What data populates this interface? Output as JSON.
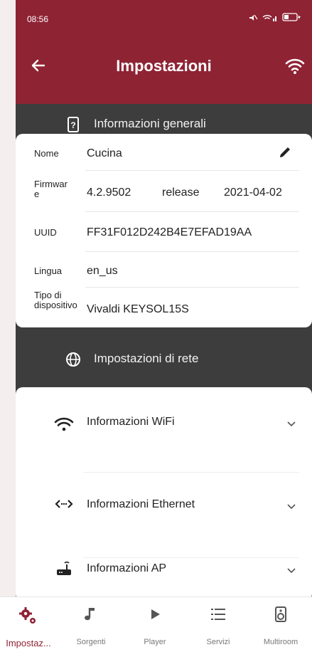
{
  "status": {
    "time": "08:56"
  },
  "appbar": {
    "title": "Impostazioni"
  },
  "general": {
    "header": "Informazioni generali",
    "rows": [
      {
        "key": "Nome",
        "value": "Cucina"
      },
      {
        "key": "Firmware",
        "value": "4.2.9502",
        "extra": "release",
        "date": "2021-04-02"
      },
      {
        "key": "UUID",
        "value": "FF31F012D242B4E7EFAD19AA"
      },
      {
        "key": "Lingua",
        "value": "en_us"
      },
      {
        "key": "Tipo di dispositivo",
        "value": "Vivaldi KEYSOL15S"
      }
    ]
  },
  "network": {
    "header": "Impostazioni di rete",
    "items": [
      {
        "label": "Informazioni WiFi",
        "icon": "wifi-icon"
      },
      {
        "label": "Informazioni Ethernet",
        "icon": "ethernet-icon"
      },
      {
        "label": "Informazioni AP",
        "icon": "router-icon"
      }
    ]
  },
  "nav": {
    "items": [
      {
        "label": "Impostaz...",
        "icon": "gears-icon",
        "active": true
      },
      {
        "label": "Sorgenti",
        "icon": "music-note-icon"
      },
      {
        "label": "Player",
        "icon": "play-icon"
      },
      {
        "label": "Servizi",
        "icon": "list-icon"
      },
      {
        "label": "Multiroom",
        "icon": "speaker-icon"
      }
    ]
  },
  "colors": {
    "primary": "#8e2334",
    "dark": "#3d3d3d"
  }
}
